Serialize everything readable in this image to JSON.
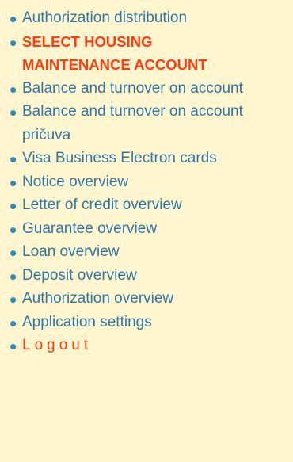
{
  "colors": {
    "background": "#fff6cf",
    "link": "#2f78a6",
    "bullet": "#2b8fbd",
    "active": "#ff3d0f"
  },
  "menu": {
    "items": [
      {
        "label": "Authorization distribution",
        "state": "normal",
        "icon": "bullet-icon"
      },
      {
        "label": "SELECT HOUSING MAINTENANCE ACCOUNT",
        "state": "active",
        "icon": "bullet-icon"
      },
      {
        "label": "Balance and turnover on account",
        "state": "normal",
        "icon": "bullet-icon"
      },
      {
        "label": "Balance and turnover on account pričuva",
        "state": "normal",
        "icon": "bullet-icon"
      },
      {
        "label": "Visa Business Electron cards",
        "state": "normal",
        "icon": "bullet-icon"
      },
      {
        "label": "Notice overview",
        "state": "normal",
        "icon": "bullet-icon"
      },
      {
        "label": "Letter of credit overview",
        "state": "normal",
        "icon": "bullet-icon"
      },
      {
        "label": "Guarantee overview",
        "state": "normal",
        "icon": "bullet-icon"
      },
      {
        "label": "Loan overview",
        "state": "normal",
        "icon": "bullet-icon"
      },
      {
        "label": "Deposit overview",
        "state": "normal",
        "icon": "bullet-icon"
      },
      {
        "label": "Authorization overview",
        "state": "normal",
        "icon": "bullet-icon"
      },
      {
        "label": "Application settings",
        "state": "normal",
        "icon": "bullet-icon"
      },
      {
        "label": "Logout",
        "state": "logout",
        "icon": "bullet-icon"
      }
    ]
  }
}
